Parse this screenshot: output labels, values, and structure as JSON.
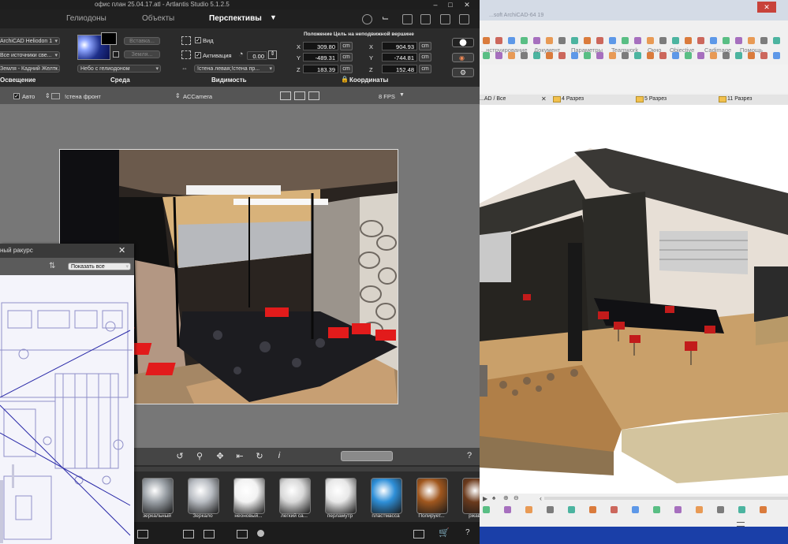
{
  "artlantis": {
    "window_title": "офис план 25.04.17.atl - Artlantis Studio 5.1.2.5",
    "tabs": [
      "Гелиодоны",
      "Объекты",
      "Перспективы"
    ],
    "active_tab": "Перспективы",
    "lighting": {
      "selects": [
        "ArchiCAD Heliodon 1",
        "Все источники све...",
        "Земля - Кадний Желт..."
      ],
      "label": "Освещение"
    },
    "environment": {
      "insert_button": "Вставка...",
      "earth_button": "Земля...",
      "sky_select": "Небо с гелиодоном",
      "label": "Среда"
    },
    "visibility": {
      "view_label": "Вид",
      "activation_label": "Активация",
      "activation_value": "0.00",
      "clip_select": "!стена левая;!стена пр...",
      "label": "Видимость"
    },
    "coordinates": {
      "header": "Положение  Цель на неподвижной вершине",
      "position": {
        "x": "309.80",
        "y": "-489.31",
        "z": "183.39"
      },
      "target": {
        "x": "904.93",
        "y": "-744.81",
        "z": "152.48"
      },
      "unit": "cm",
      "label": "Координаты"
    },
    "options_bar": {
      "auto_label": "Авто",
      "wall_select": "!стена фронт",
      "camera_select": "ACCamera",
      "fps_select": "8 FPS"
    },
    "plan_window": {
      "title": "ный ракурс",
      "show_all_select": "Показать все"
    },
    "help_glyph": "?",
    "materials": [
      {
        "label": "зеркальный",
        "color": "#9aa0a6"
      },
      {
        "label": "Зеркало",
        "color": "#b8bcc2"
      },
      {
        "label": "неоновый...",
        "color": "#f2f2f2"
      },
      {
        "label": "легкий са...",
        "color": "#d8d8d8"
      },
      {
        "label": "перламутр",
        "color": "#e8e8e8"
      },
      {
        "label": "пластмасса",
        "color": "#2e8fd8"
      },
      {
        "label": "Полирует...",
        "color": "#a0571e"
      },
      {
        "label": "ржавчи",
        "color": "#6b3a1c"
      }
    ]
  },
  "archicad": {
    "window_title": "...soft ArchiCAD-64 19",
    "menu": [
      "...нструирование",
      "Документ",
      "Параметры",
      "Teamwork",
      "Окно",
      "Objective",
      "Cadimage",
      "Помощь"
    ],
    "view_tabs": [
      "...AD / Все",
      "4 Разрез",
      "5 Разрез",
      "11 Разрез"
    ],
    "accent_color": "#1a3fa8"
  }
}
